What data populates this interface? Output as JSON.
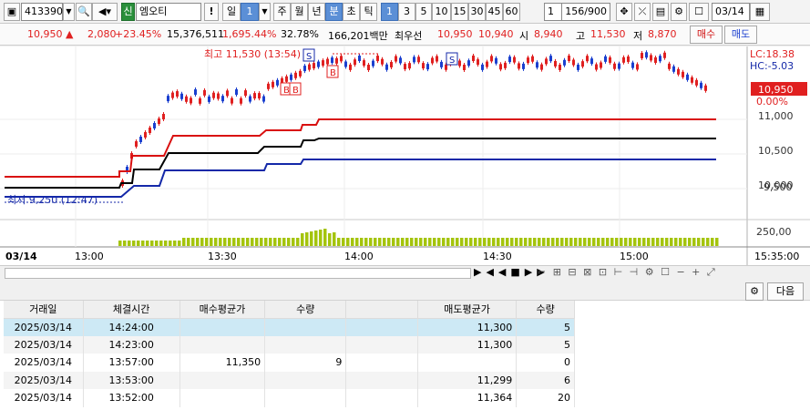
{
  "toolbar": {
    "code": "413390",
    "code_box_icon": "dropdown-arrow-icon",
    "market_badge": "신",
    "name": "엠오티",
    "excl": "!",
    "period_day": "일",
    "period_num": "1",
    "periods": [
      "주",
      "월",
      "년",
      "분",
      "초",
      "틱"
    ],
    "intervals": [
      "1",
      "3",
      "5",
      "10",
      "15",
      "30",
      "45",
      "60"
    ],
    "count": "1",
    "range": "156/900",
    "date": "03/14"
  },
  "quote": {
    "price": "10,950",
    "arrow": "▲",
    "change": "2,080",
    "rate": "+23.45%",
    "volume": "15,376,511",
    "vol_rate": "1,695.44%",
    "turnover": "32.78%",
    "amount": "166,201백만",
    "best": "최우선",
    "ask": "10,950",
    "bid": "10,940",
    "open_label": "시",
    "open": "8,940",
    "high_label": "고",
    "high": "11,530",
    "low_label": "저",
    "low": "8,870",
    "buy": "매수",
    "sell": "매도"
  },
  "chart": {
    "high_note": "최고 11,530 (13:54)",
    "low_note": "최저 9,250 (12:47)",
    "lc": "LC:18.38",
    "hc": "HC:-5.03",
    "cur_price": "10,950",
    "cur_rate": "0.00%",
    "yticks": [
      "11,000",
      "10,500",
      "10,000",
      "9,500"
    ],
    "vol_tick": "250,00",
    "date_label": "03/14",
    "times": [
      "13:00",
      "13:30",
      "14:00",
      "14:30",
      "15:00"
    ],
    "end_time": "15:35:00",
    "markers": {
      "s": "S",
      "b": "B"
    },
    "colors": {
      "up": "#e02020",
      "down": "#1a3fcf",
      "band_red": "#d91010",
      "band_black": "#000000",
      "band_blue": "#1428a8",
      "volume": "#a4c40c"
    }
  },
  "bottom": {
    "next": "다음",
    "gear_icon": "gear-icon"
  },
  "table": {
    "headers": [
      "거래일",
      "체결시간",
      "매수평균가",
      "수량",
      "",
      "매도평균가",
      "수량"
    ],
    "rows": [
      [
        "2025/03/14",
        "14:24:00",
        "",
        "",
        "",
        "11,300",
        "5"
      ],
      [
        "2025/03/14",
        "14:23:00",
        "",
        "",
        "",
        "11,300",
        "5"
      ],
      [
        "2025/03/14",
        "13:57:00",
        "11,350",
        "9",
        "",
        "",
        "0"
      ],
      [
        "2025/03/14",
        "13:53:00",
        "",
        "",
        "",
        "11,299",
        "6"
      ],
      [
        "2025/03/14",
        "13:52:00",
        "",
        "",
        "",
        "11,364",
        "20"
      ]
    ]
  }
}
